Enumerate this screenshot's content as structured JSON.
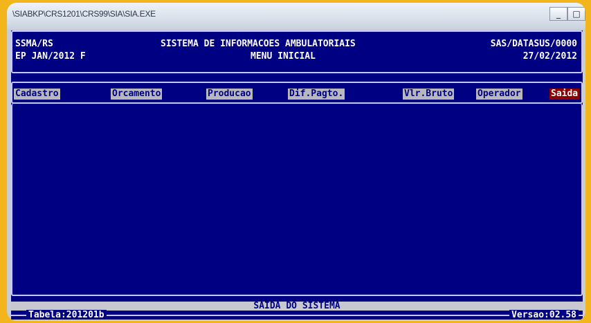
{
  "window": {
    "title": "\\SIABKP\\CRS1201\\CRS99\\SIA\\SIA.EXE",
    "minimize_glyph": "_",
    "restore_glyph": "□"
  },
  "header": {
    "org": "SSMA/RS",
    "ep": "EP JAN/2012 F",
    "system": "SISTEMA DE INFORMACOES AMBULATORIAIS",
    "screen": "MENU INICIAL",
    "sas": "SAS/DATASUS/0000",
    "date": "27/02/2012"
  },
  "menu": [
    {
      "label": "Cadastro",
      "selected": false
    },
    {
      "label": "Orcamento",
      "selected": false
    },
    {
      "label": "Producao",
      "selected": false
    },
    {
      "label": "Dif.Pagto.",
      "selected": false
    },
    {
      "label": "Vlr.Bruto",
      "selected": false
    },
    {
      "label": "Operador",
      "selected": false
    },
    {
      "label": "Saida",
      "selected": true
    }
  ],
  "status": {
    "message": "SAIDA DO SISTEMA",
    "tabela": "Tabela:201201b",
    "versao": "Versao:02.58"
  },
  "colors": {
    "background": "#f2b61c",
    "console": "#000083",
    "menu_item": "#b8b8bc",
    "menu_selected": "#8b0000"
  }
}
